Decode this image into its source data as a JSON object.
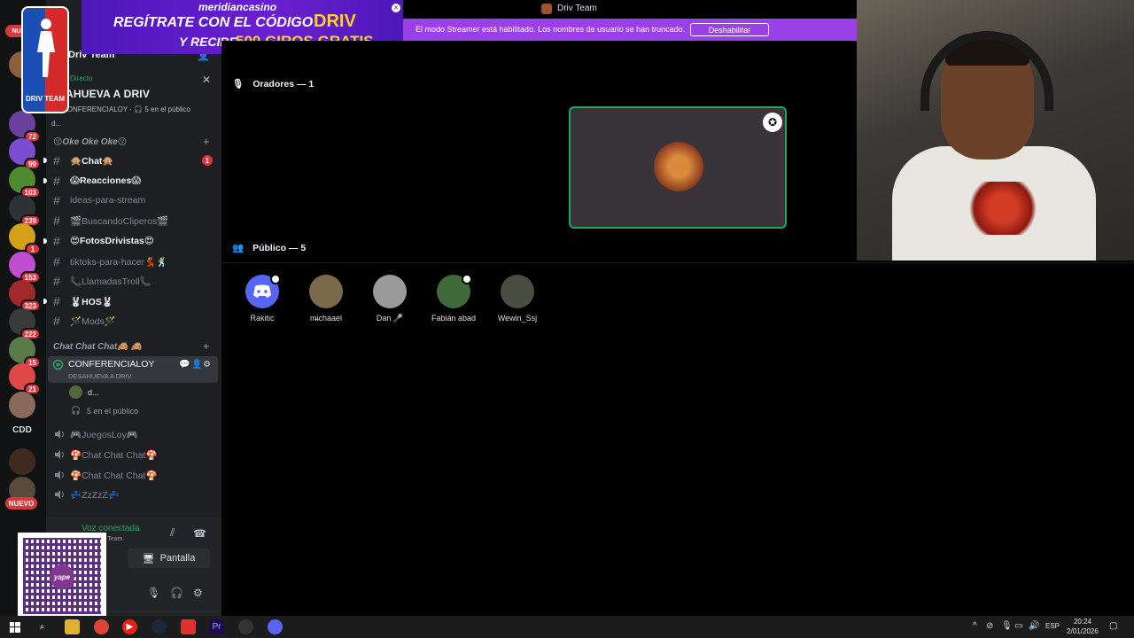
{
  "window": {
    "title": "Driv Team"
  },
  "streamer": {
    "message": "El modo Streamer está habilitado. Los nombres de usuario se han truncado.",
    "disable_label": "Deshabilitar"
  },
  "ad": {
    "brand": "meridiancasino",
    "line1": "REGÍTRATE CON EL CÓDIGO",
    "code": "DRIV",
    "line2a": "Y RECIBE",
    "line2b": "500 GIROS GRATIS"
  },
  "logo": {
    "text": "DRIV TEAM"
  },
  "rail": {
    "top_badge": "NUE",
    "badges": [
      "1",
      "72",
      "99",
      "103",
      "239",
      "1",
      "153",
      "323",
      "222",
      "15",
      "21"
    ],
    "cdd": "CDD",
    "new_label": "NUEVO"
  },
  "server": {
    "name": "Driv Team"
  },
  "live": {
    "label": "Directo",
    "title": "AHUEVA A DRIV",
    "meta": "CONFERENCIALOY · 🎧 5 en el público",
    "user": "d..."
  },
  "categories": [
    {
      "name": "😗Oke Oke Oke😗"
    },
    {
      "name": "Chat Chat Chat🙈 🙈"
    }
  ],
  "channels": [
    {
      "name": "🙊Chat🙊",
      "unread": true,
      "mention": "1"
    },
    {
      "name": "😱Reacciones😱",
      "unread": true
    },
    {
      "name": "ideas-para-stream",
      "unread": false
    },
    {
      "name": "🎬BuscandoCliperos🎬",
      "unread": false
    },
    {
      "name": "😍FotosDrivistas😍",
      "unread": true
    },
    {
      "name": "tiktoks-para-hacer💃🕺",
      "unread": false
    },
    {
      "name": "📞LlamadasTroll📞",
      "unread": false
    },
    {
      "name": "🐰HOS🐰",
      "unread": true
    },
    {
      "name": "🪄Mods🪄",
      "unread": false
    }
  ],
  "active_voice": {
    "name": "CONFERENCIALOY",
    "status": "DESAHUEVA A DRIV",
    "user": "d...",
    "public": "5 en el público"
  },
  "voice_channels": [
    {
      "name": "🎮JuegosLoy🎮"
    },
    {
      "name": "🍄Chat Chat Chat🍄"
    },
    {
      "name": "🍄Chat Chat Chat🍄"
    },
    {
      "name": "💤ZzZzZ💤"
    }
  ],
  "user_panel": {
    "voice_connected": "Voz conectada",
    "voice_sub": "riv Team",
    "screen_label": "Pantalla"
  },
  "qr": {
    "center": "yape"
  },
  "stage": {
    "speakers_label": "Oradores — 1",
    "public_label": "Público — 5",
    "audience": [
      {
        "name": "Rakitic",
        "color": "#5865f2"
      },
      {
        "name": "m̶ichaael",
        "color": "#7a6a4a"
      },
      {
        "name": "Dan 🎤",
        "color": "#9a9a9a"
      },
      {
        "name": "Fabián abad",
        "color": "#3f6b3a"
      },
      {
        "name": "Wewin_Ssj",
        "color": "#4a4d42"
      }
    ]
  },
  "taskbar": {
    "lang": "ESP",
    "time": "20:24",
    "date": "2/01/2026"
  }
}
